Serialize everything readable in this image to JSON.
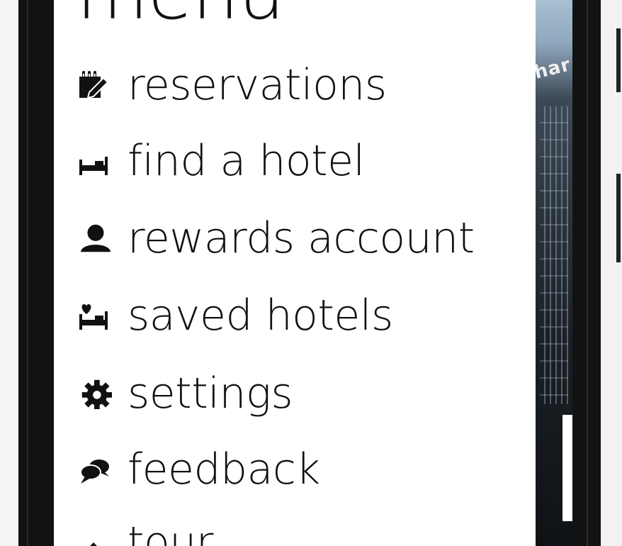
{
  "menu": {
    "title": "menu",
    "items": [
      {
        "label": "reservations",
        "icon": "reservations-icon"
      },
      {
        "label": "find a hotel",
        "icon": "bed-icon"
      },
      {
        "label": "rewards account",
        "icon": "person-icon"
      },
      {
        "label": "saved hotels",
        "icon": "saved-hotel-icon"
      },
      {
        "label": "settings",
        "icon": "gear-icon"
      },
      {
        "label": "feedback",
        "icon": "speech-bubbles-icon"
      },
      {
        "label": "tour",
        "icon": "arrow-up-icon"
      }
    ]
  },
  "background": {
    "sign_text": "har"
  },
  "colors": {
    "menu_background": "#ffffff",
    "text": "#111111",
    "bezel": "#111111"
  }
}
